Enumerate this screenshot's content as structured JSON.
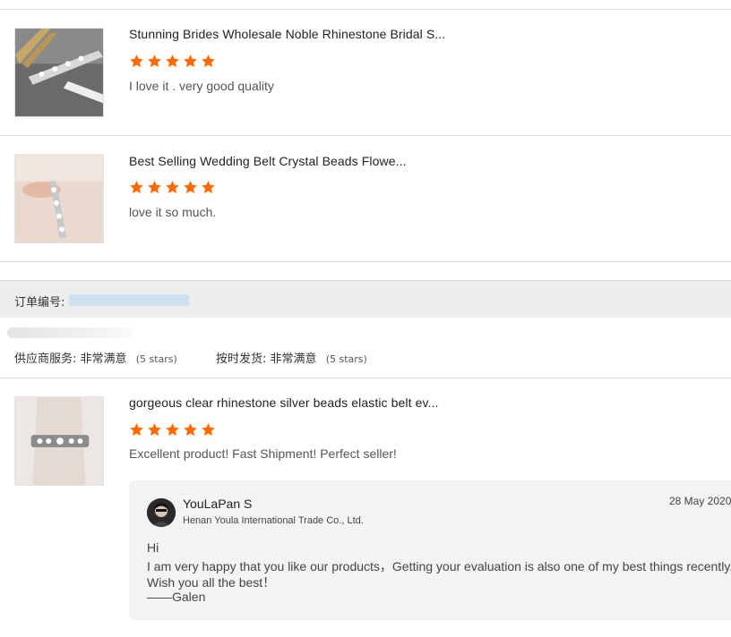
{
  "reviews": [
    {
      "title": "Stunning Brides Wholesale Noble Rhinestone Bridal S...",
      "stars": 5,
      "text": "I love it . very good quality"
    },
    {
      "title": "Best Selling Wedding Belt Crystal Beads Flowe...",
      "stars": 5,
      "text": "love it so much."
    },
    {
      "title": "gorgeous clear rhinestone silver beads elastic belt ev...",
      "stars": 5,
      "text": "Excellent product!  Fast Shipment!  Perfect seller!"
    }
  ],
  "order": {
    "label": "订单编号:"
  },
  "seller_ratings": {
    "service_label": "供应商服务:",
    "service_value": "非常满意",
    "service_stars": "(5 stars)",
    "shipping_label": "按时发货:",
    "shipping_value": "非常满意",
    "shipping_stars": "(5 stars)"
  },
  "reply": {
    "name": "YouLaPan S",
    "company": "Henan Youla International Trade Co., Ltd.",
    "date": "28 May 2020",
    "lines": [
      "Hi",
      "I am very happy that you like our products，Getting your evaluation is also one of my best things recently.",
      "Wish you all the best！",
      "——Galen"
    ]
  },
  "colors": {
    "star": "#ff6a00",
    "divider": "#dcdcdc",
    "order_bar": "#eeeeee",
    "reply_bg": "#f2f3f5"
  }
}
